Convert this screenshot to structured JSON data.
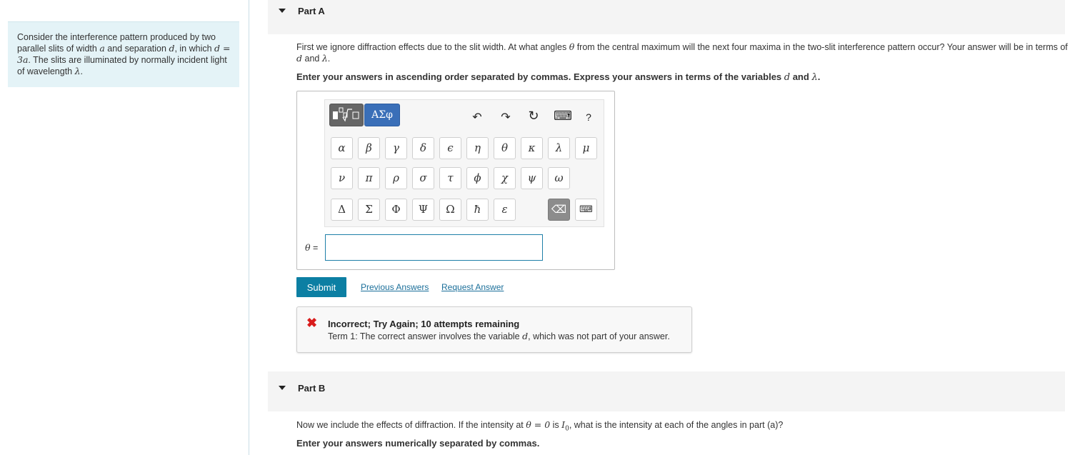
{
  "problem": {
    "t1": "Consider the interference pattern produced by two parallel slits of width ",
    "v_a": "a",
    "t2": " and separation ",
    "v_d": "d",
    "t3": ", in which ",
    "eq": "d = 3a",
    "t4": ". The slits are illuminated by normally incident light of wavelength ",
    "v_lambda": "λ",
    "t5": "."
  },
  "partA": {
    "title": "Part A",
    "q1": "First we ignore diffraction effects due to the slit width. At what angles ",
    "theta": "θ",
    "q2": " from the central maximum will the next four maxima in the two-slit interference pattern occur? Your answer will be in terms of ",
    "d": "d",
    "and": " and ",
    "lambda": "λ",
    "end": ".",
    "instr1": "Enter your answers in ascending order separated by commas. Express your answers in terms of the variables ",
    "instr_d": "d",
    "instr_and": " and ",
    "instr_lambda": "λ",
    "instr_end": "."
  },
  "editor": {
    "tab_templates_icon": "templates-icon",
    "tab_greek_label": "ΑΣφ",
    "toolbar": {
      "undo": "↶",
      "redo": "↷",
      "reset": "↻",
      "keyboard": "⌨",
      "help": "?"
    },
    "row1": [
      "α",
      "β",
      "γ",
      "δ",
      "ϵ",
      "η",
      "θ",
      "κ",
      "λ",
      "μ"
    ],
    "row2": [
      "ν",
      "π",
      "ρ",
      "σ",
      "τ",
      "ϕ",
      "χ",
      "ψ",
      "ω"
    ],
    "row3": [
      "Δ",
      "Σ",
      "Φ",
      "Ψ",
      "Ω",
      "ħ",
      "ε"
    ],
    "backspace": "⌫",
    "keyboard_toggle": "⌨",
    "answer_label_var": "θ",
    "answer_label_eq": " =",
    "answer_value": ""
  },
  "actions": {
    "submit": "Submit",
    "previous_answers": "Previous Answers",
    "request_answer": "Request Answer"
  },
  "feedback": {
    "icon": "✖",
    "title": "Incorrect; Try Again; 10 attempts remaining",
    "d1": "Term 1: The correct answer involves the variable ",
    "var": "d",
    "d2": ", which was not part of your answer."
  },
  "partB": {
    "title": "Part B",
    "q1": "Now we include the effects of diffraction. If the intensity at ",
    "eq": "θ = 0",
    "q2": " is ",
    "I0": "I",
    "I0_sub": "0",
    "q3": ", what is the intensity at each of the angles in part (a)?",
    "instr": "Enter your answers numerically separated by commas."
  },
  "colors": {
    "submit": "#0c7fa3",
    "link": "#1b6f9a",
    "error": "#d91c1c",
    "left_panel": "#e4f3f7",
    "greek_tab": "#3a6fb8"
  }
}
